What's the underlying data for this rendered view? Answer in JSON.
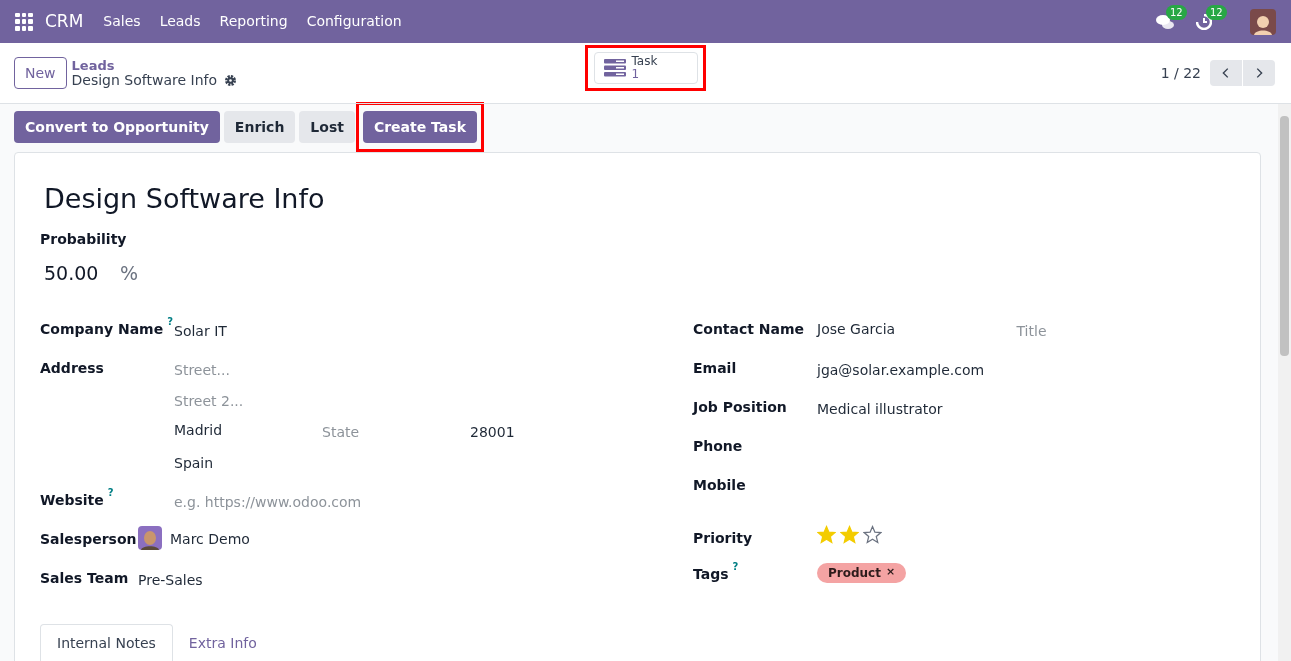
{
  "navbar": {
    "app": "CRM",
    "menu": [
      "Sales",
      "Leads",
      "Reporting",
      "Configuration"
    ],
    "messages_badge": "12",
    "activities_badge": "12"
  },
  "control_panel": {
    "new_button": "New",
    "breadcrumb_parent": "Leads",
    "breadcrumb_current": "Design Software Info",
    "smart_button": {
      "label": "Task",
      "value": "1",
      "highlighted": true
    },
    "pager": "1 / 22"
  },
  "actions": [
    {
      "label": "Convert to Opportunity",
      "kind": "primary",
      "highlighted": false
    },
    {
      "label": "Enrich",
      "kind": "secondary",
      "highlighted": false
    },
    {
      "label": "Lost",
      "kind": "secondary",
      "highlighted": false
    },
    {
      "label": "Create Task",
      "kind": "primary",
      "highlighted": true
    }
  ],
  "form": {
    "title": "Design Software Info",
    "probability": {
      "label": "Probability",
      "value": "50.00",
      "unit": "%"
    },
    "left_fields": [
      {
        "kind": "value",
        "label": "Company Name",
        "help": "?",
        "value": "Solar IT"
      },
      {
        "kind": "address",
        "label": "Address",
        "street": "Street...",
        "street2": "Street 2...",
        "city": "Madrid",
        "state": "State",
        "zip": "28001",
        "country": "Spain"
      },
      {
        "kind": "placeholder",
        "label": "Website",
        "help": "?",
        "placeholder": "e.g. https://www.odoo.com"
      },
      {
        "kind": "user",
        "label": "Salesperson",
        "value": "Marc Demo"
      },
      {
        "kind": "value",
        "label": "Sales Team",
        "value": "Pre-Sales"
      }
    ],
    "right_fields": [
      {
        "kind": "contact",
        "label": "Contact Name",
        "value": "Jose Garcia",
        "placeholder": "Title"
      },
      {
        "kind": "value",
        "label": "Email",
        "value": "jga@solar.example.com"
      },
      {
        "kind": "value",
        "label": "Job Position",
        "value": "Medical illustrator"
      },
      {
        "kind": "value",
        "label": "Phone"
      },
      {
        "kind": "value",
        "label": "Mobile"
      },
      {
        "kind": "stars",
        "label": "Priority",
        "stars": 2
      },
      {
        "kind": "tags",
        "label": "Tags",
        "help": "?",
        "tags": [
          {
            "label": "Product",
            "remove": "×",
            "color": "#f4a3a3"
          }
        ]
      }
    ],
    "tabs": [
      {
        "label": "Internal Notes",
        "selected": true
      },
      {
        "label": "Extra Info",
        "selected": false
      }
    ]
  }
}
